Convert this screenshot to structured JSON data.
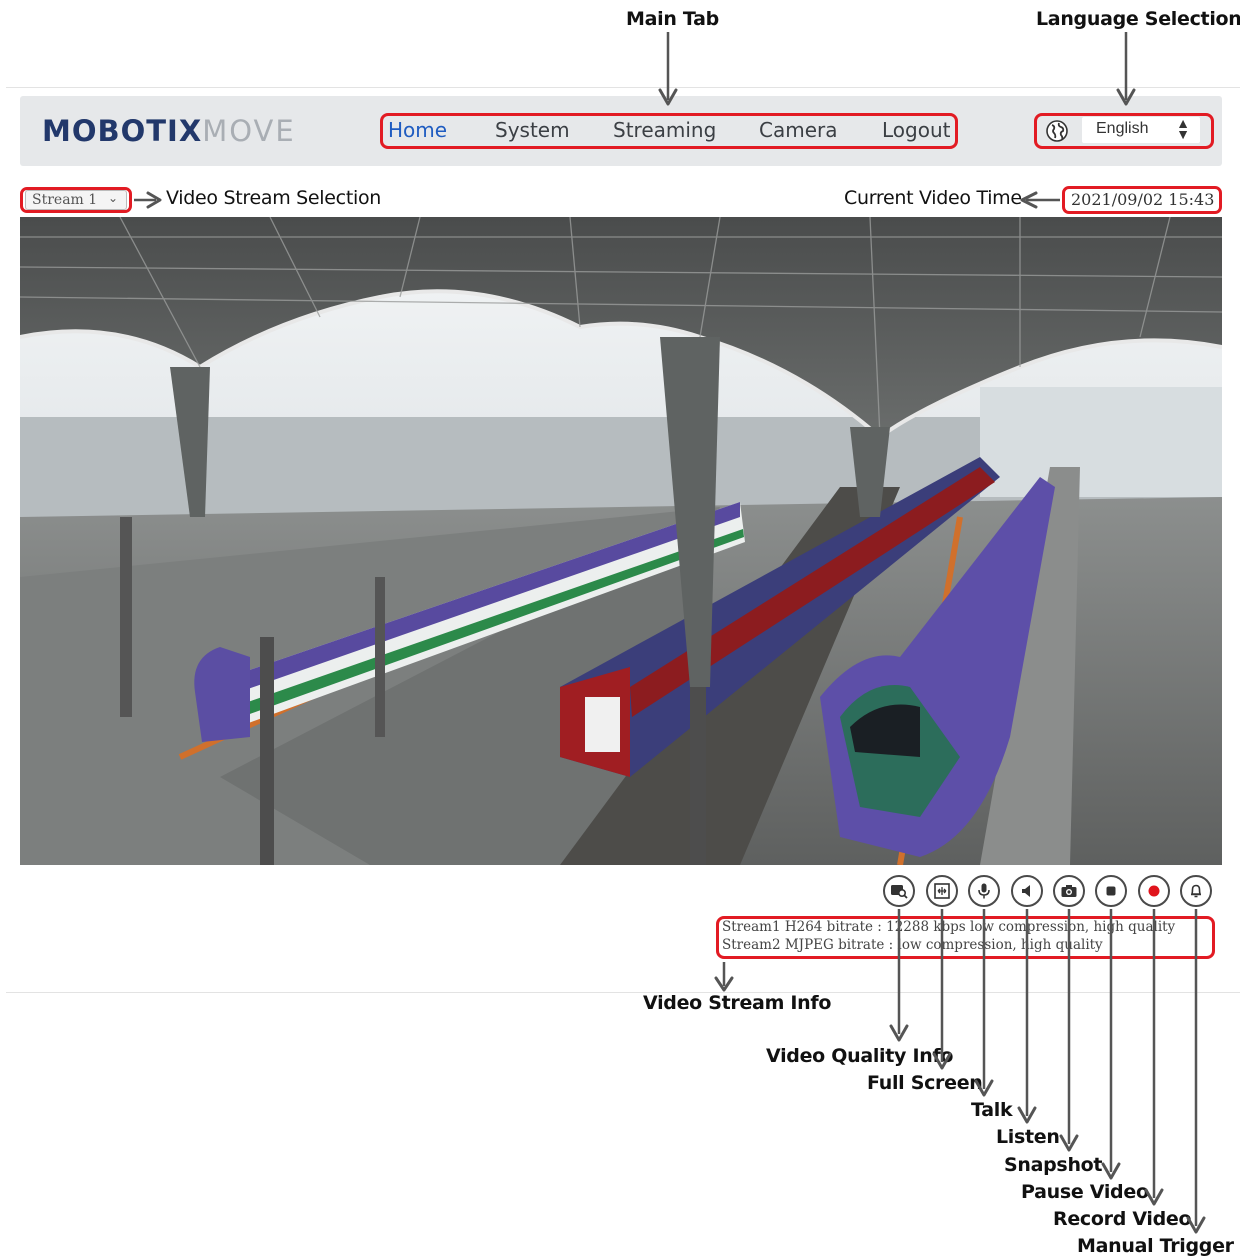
{
  "annotations": {
    "main_tab": "Main Tab",
    "language_selection": "Language Selection",
    "video_stream_selection": "Video Stream Selection",
    "current_video_time": "Current Video Time",
    "video_stream_info": "Video Stream Info",
    "video_quality_info": "Video Quality Info",
    "full_screen": "Full Screen",
    "talk": "Talk",
    "listen": "Listen",
    "snapshot": "Snapshot",
    "pause_video": "Pause Video",
    "record_video": "Record Video",
    "manual_trigger": "Manual Trigger"
  },
  "header": {
    "logo_brand": "MOBOTIX",
    "logo_product": "MOVE",
    "tabs": [
      {
        "label": "Home",
        "active": true
      },
      {
        "label": "System",
        "active": false
      },
      {
        "label": "Streaming",
        "active": false
      },
      {
        "label": "Camera",
        "active": false
      },
      {
        "label": "Logout",
        "active": false
      }
    ],
    "language": {
      "selected": "English",
      "icon": "globe-icon"
    }
  },
  "stream_select": {
    "selected": "Stream 1"
  },
  "video_time": "2021/09/02 15:43",
  "controls": [
    {
      "name": "video-quality-info",
      "icon": "video-search-icon"
    },
    {
      "name": "full-screen",
      "icon": "fullscreen-icon"
    },
    {
      "name": "talk",
      "icon": "microphone-icon"
    },
    {
      "name": "listen",
      "icon": "speaker-icon"
    },
    {
      "name": "snapshot",
      "icon": "camera-icon"
    },
    {
      "name": "pause-video",
      "icon": "stop-icon"
    },
    {
      "name": "record-video",
      "icon": "record-icon"
    },
    {
      "name": "manual-trigger",
      "icon": "bell-icon"
    }
  ],
  "stream_info": [
    "Stream1 H264 bitrate : 12288 kbps low compression, high quality",
    "Stream2 MJPEG bitrate : low compression, high quality"
  ],
  "colors": {
    "highlight": "#e21b23",
    "active_tab": "#1f5cc1",
    "brand": "#22386b",
    "record": "#e0141c"
  }
}
